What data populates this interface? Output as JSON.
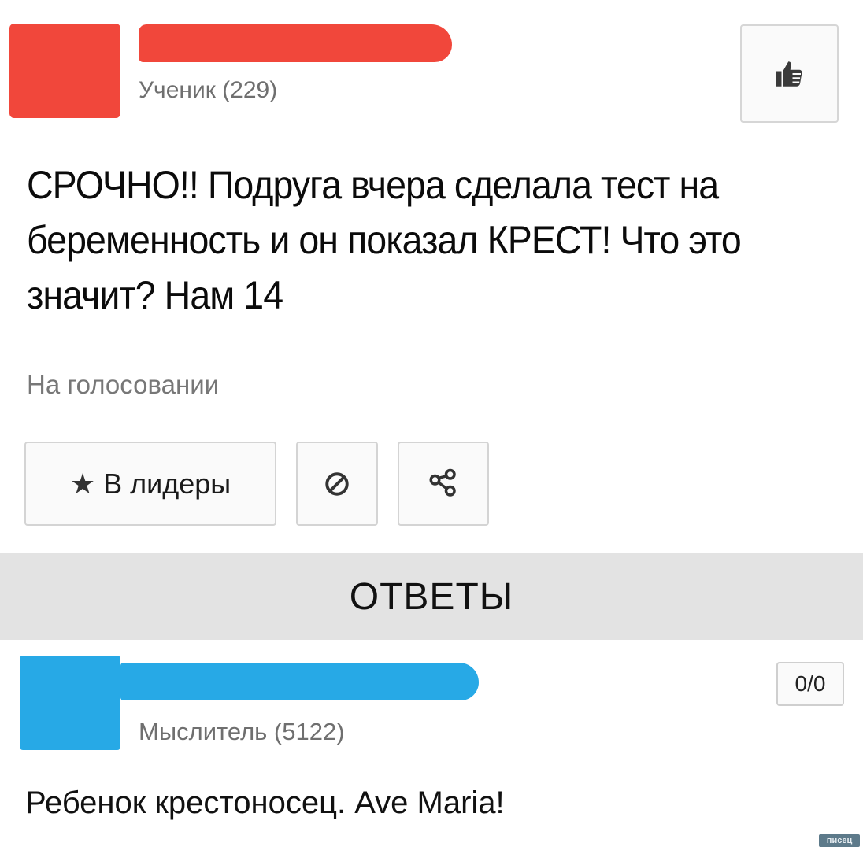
{
  "question": {
    "author_rank": "Ученик (229)",
    "text": "СРОЧНО!! Подруга вчера сделала тест на беременность и он показал КРЕСТ! Что это значит? Нам 14",
    "status": "На голосовании",
    "actions": {
      "leaders_icon": "star-icon",
      "leaders_label": "В лидеры",
      "block_icon": "block-icon",
      "share_icon": "share-icon"
    },
    "like_icon": "thumbs-up-icon"
  },
  "answers_header": "ОТВЕТЫ",
  "answer": {
    "author_rank": "Мыслитель (5122)",
    "score": "0/0",
    "text": "Ребенок крестоносец. Ave Maria!"
  },
  "watermark": "писец",
  "colors": {
    "question_author_redaction": "#f1473b",
    "answer_author_redaction": "#27a9e6",
    "answers_bar": "#e3e3e3"
  }
}
